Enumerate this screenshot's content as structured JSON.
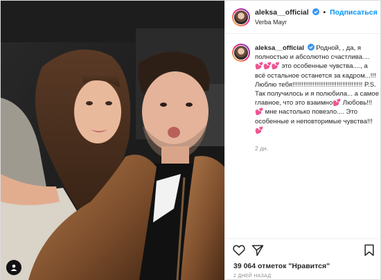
{
  "header": {
    "username": "aleksa__official",
    "separator": "•",
    "follow_label": "Подписаться",
    "location": "Verba Mayr"
  },
  "caption": {
    "username": "aleksa__official",
    "text": "Родной, , да, я полностью и абсолютно счастлива.... 💕💕💕 это особенные чувства...., а всё остальное останется за кадром...!!! Люблю тебя!!!!!!!!!!!!!!!!!!!!!!!!!!!!!!!!!!!!!! P.S. Так получилось и я полюбила... а самое главное, что это взаимно💕 Любовь!!!💕 мне настолько повезло.... Это особенные и неповторимые чувства!!!💕",
    "time": "2 дн."
  },
  "actions": {
    "likes": "39 064 отметок \"Нравится\"",
    "date": "2 ДНЕЙ НАЗАД"
  },
  "icons": [
    "heart-icon",
    "share-icon",
    "bookmark-icon",
    "user-tag-icon",
    "verified-badge-icon"
  ],
  "colors": {
    "follow": "#0095f6",
    "verified": "#3897f0",
    "muted": "#8e8e8e"
  }
}
